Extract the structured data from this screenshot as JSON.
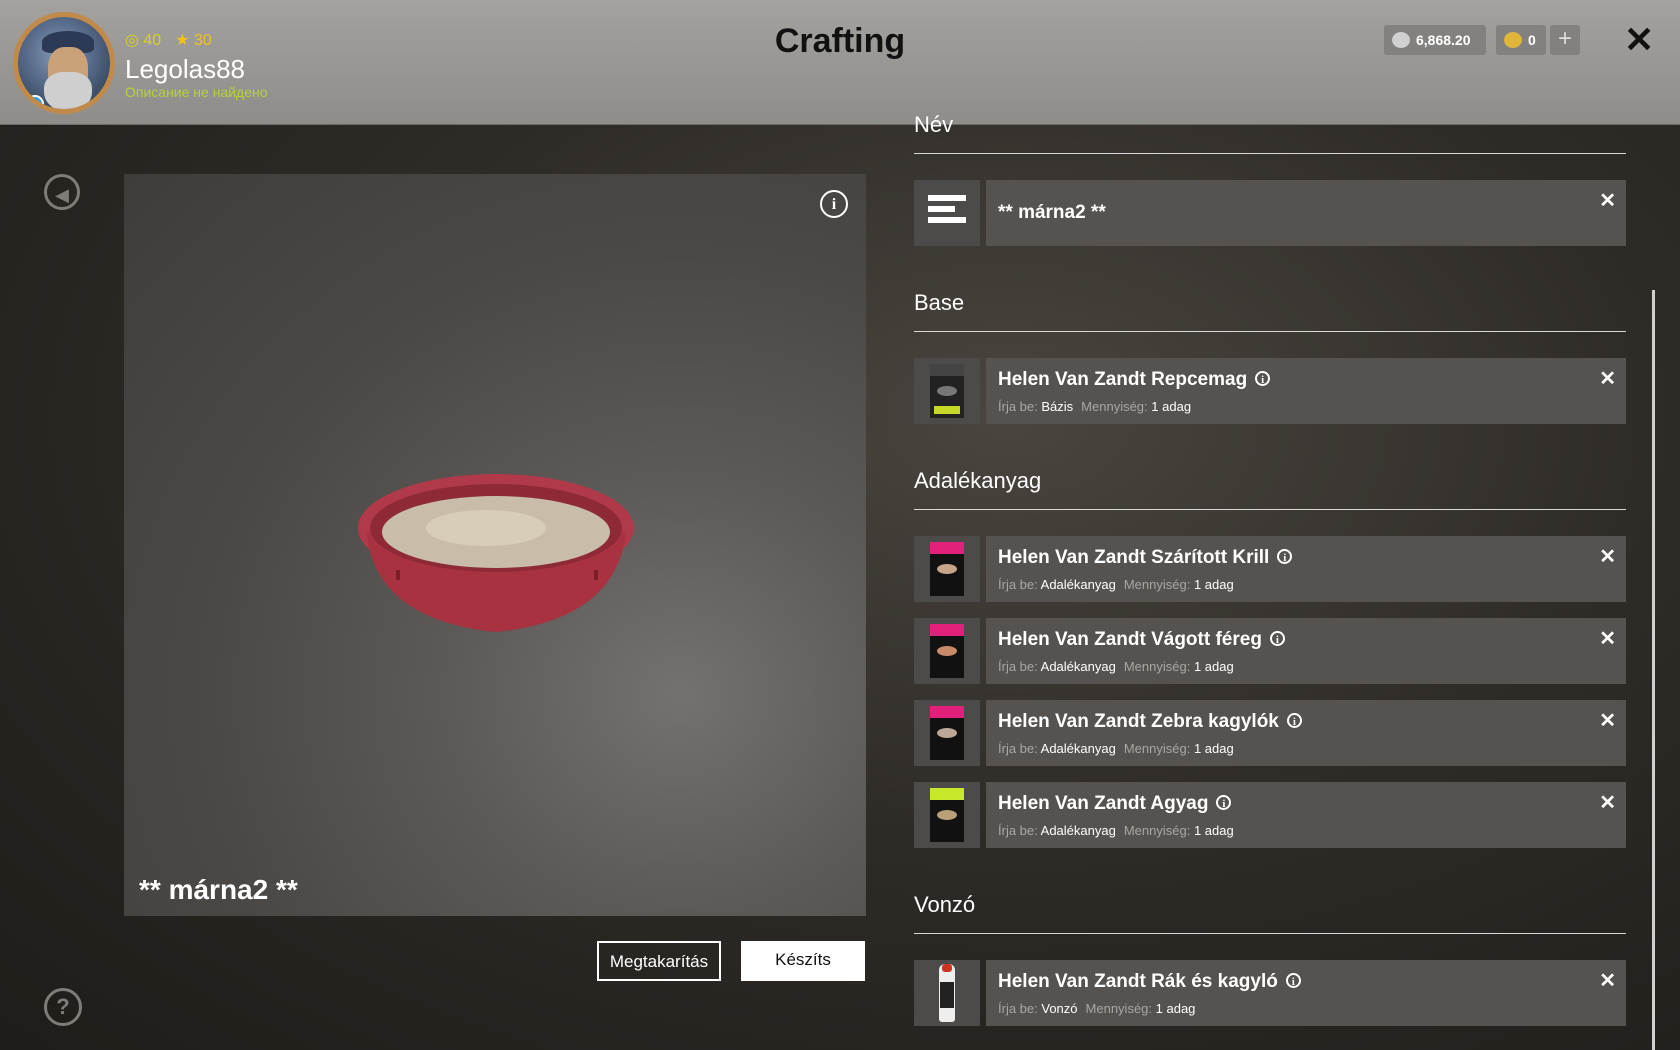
{
  "header": {
    "title": "Crafting",
    "user": {
      "level": "40",
      "stars": "30",
      "name": "Legolas88",
      "description": "Описание не найдено"
    },
    "currency": {
      "silver": "6,868.20",
      "gold": "0"
    },
    "plus_label": "+",
    "close_label": "✕"
  },
  "preview": {
    "info_label": "i",
    "name": "** márna2 **",
    "save_button": "Megtakarítás",
    "make_button": "Készíts"
  },
  "nav": {
    "back_label": "◀",
    "help_label": "?"
  },
  "sections": {
    "name": {
      "heading": "Név",
      "value": "** márna2 **"
    },
    "base": {
      "heading": "Base",
      "items": [
        {
          "title": "Helen Van Zandt Repcemag",
          "type_label": "Írja be:",
          "type": "Bázis",
          "qty_label": "Mennyiség:",
          "qty": "1 adag"
        }
      ]
    },
    "additive": {
      "heading": "Adalékanyag",
      "items": [
        {
          "title": "Helen Van Zandt Szárított Krill",
          "type_label": "Írja be:",
          "type": "Adalékanyag",
          "qty_label": "Mennyiség:",
          "qty": "1 adag"
        },
        {
          "title": "Helen Van Zandt Vágott féreg",
          "type_label": "Írja be:",
          "type": "Adalékanyag",
          "qty_label": "Mennyiség:",
          "qty": "1 adag"
        },
        {
          "title": "Helen Van Zandt Zebra kagylók",
          "type_label": "Írja be:",
          "type": "Adalékanyag",
          "qty_label": "Mennyiség:",
          "qty": "1 adag"
        },
        {
          "title": "Helen Van Zandt Agyag",
          "type_label": "Írja be:",
          "type": "Adalékanyag",
          "qty_label": "Mennyiség:",
          "qty": "1 adag"
        }
      ]
    },
    "attractant": {
      "heading": "Vonzó",
      "items": [
        {
          "title": "Helen Van Zandt Rák és kagyló",
          "type_label": "Írja be:",
          "type": "Vonzó",
          "qty_label": "Mennyiség:",
          "qty": "1 adag"
        }
      ]
    }
  },
  "row_close_label": "✕",
  "row_info_label": "i",
  "colors": {
    "header_bg": "#9a9895",
    "accent_green": "#b6d23a",
    "row_bg": "#55524f",
    "bowl_red": "#b03a4a"
  }
}
